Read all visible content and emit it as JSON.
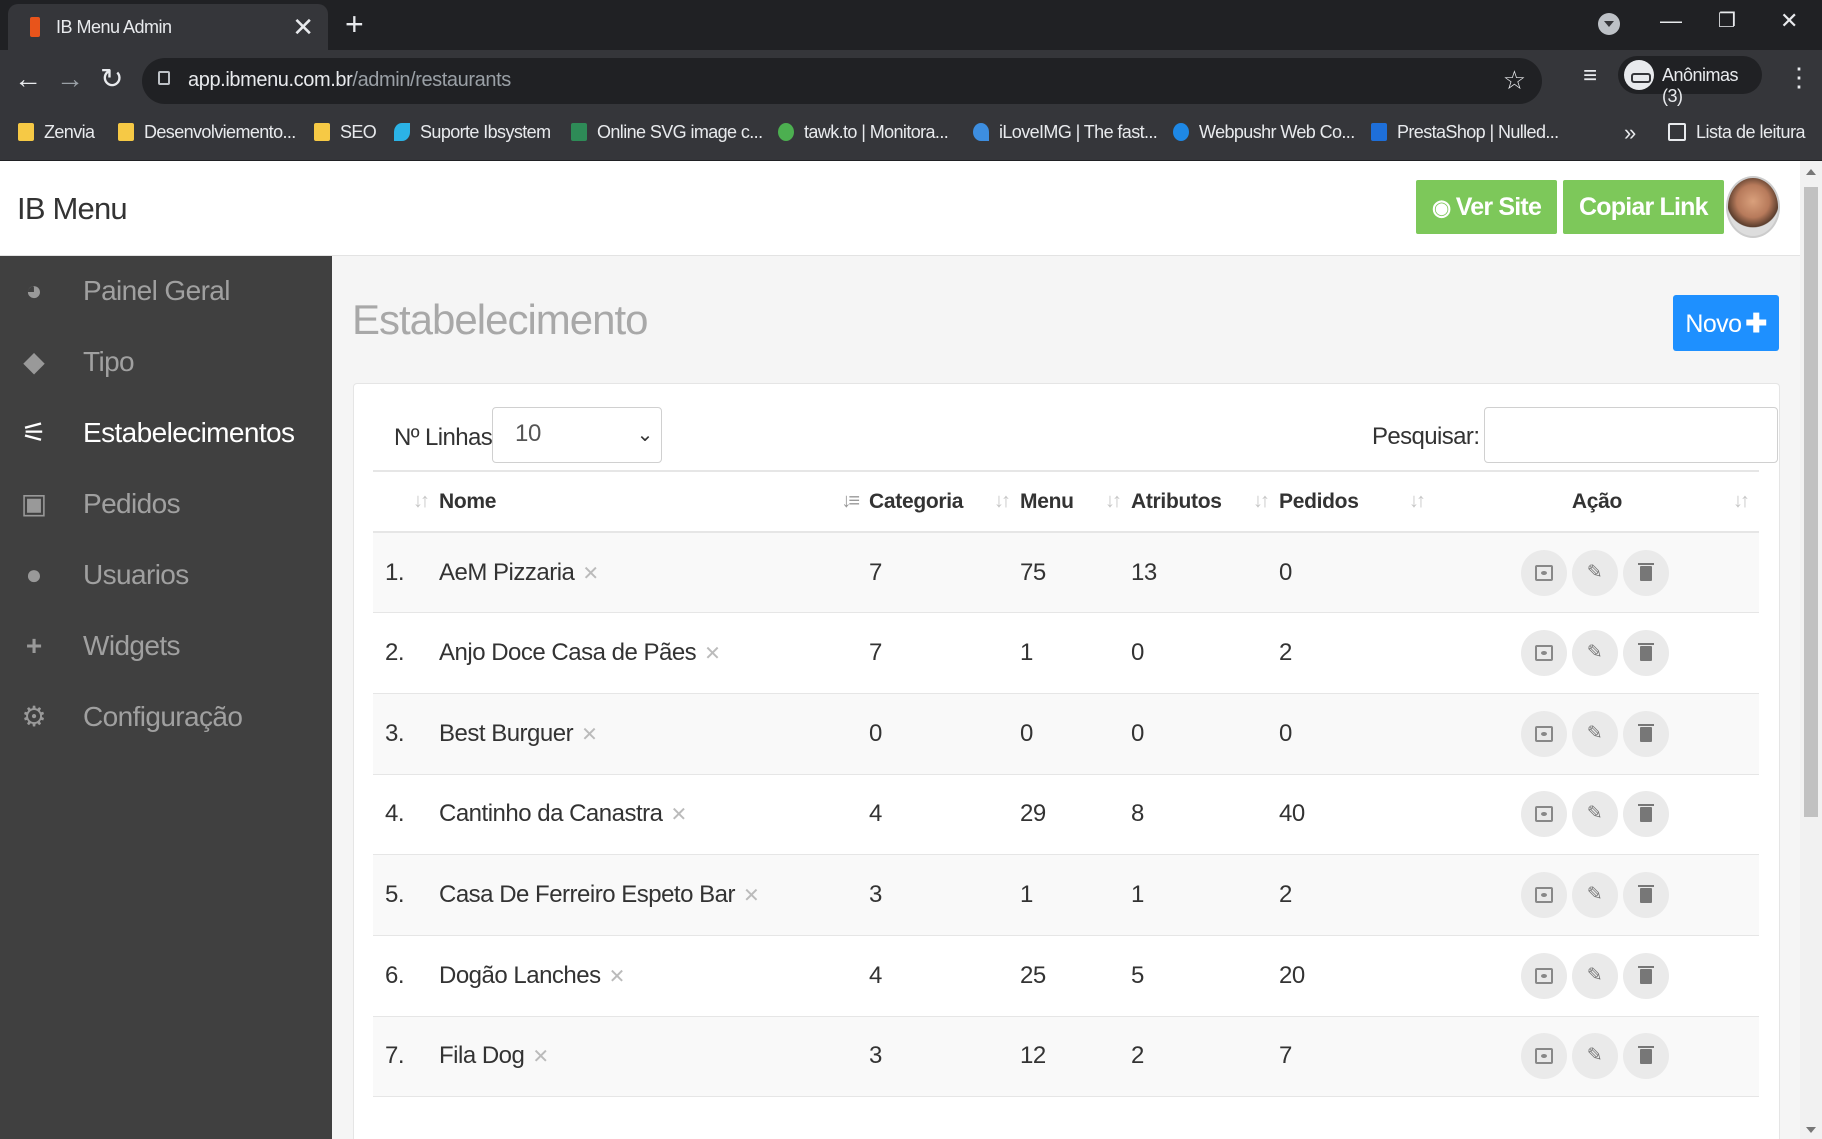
{
  "browser": {
    "tab_title": "IB Menu Admin",
    "tab_close": "✕",
    "new_tab": "+",
    "url_host": "app.ibmenu.com.br",
    "url_path": "/admin/restaurants",
    "profile_label": "Anônimas (3)",
    "bookmarks": [
      {
        "label": "Zenvia",
        "icon": "folder-icon",
        "color": "#f6c945"
      },
      {
        "label": "Desenvolviemento...",
        "icon": "folder-icon",
        "color": "#f6c945"
      },
      {
        "label": "SEO",
        "icon": "folder-icon",
        "color": "#f6c945"
      },
      {
        "label": "Suporte Ibsystem",
        "icon": "bird-icon",
        "color": "#2bb3e6"
      },
      {
        "label": "Online SVG image c...",
        "icon": "svg-icon",
        "color": "#2e8b57"
      },
      {
        "label": "tawk.to | Monitora...",
        "icon": "tawk-icon",
        "color": "#4caf50"
      },
      {
        "label": "iLoveIMG | The fast...",
        "icon": "heart-icon",
        "color": "#3d8ee0"
      },
      {
        "label": "Webpushr Web Co...",
        "icon": "drop-icon",
        "color": "#1e88e5"
      },
      {
        "label": "PrestaShop | Nulled...",
        "icon": "n-icon",
        "color": "#1e6fd9"
      }
    ],
    "more_bookmarks": "»",
    "reading_list": "Lista de leitura"
  },
  "app": {
    "brand": "IB Menu",
    "ver_site": "Ver Site",
    "copiar_link": "Copiar Link",
    "accent_green": "#7dc85a",
    "accent_blue": "#1e90ff"
  },
  "sidebar": {
    "items": [
      {
        "label": "Painel Geral",
        "icon": "dashboard-icon",
        "active": false
      },
      {
        "label": "Tipo",
        "icon": "tags-icon",
        "active": false
      },
      {
        "label": "Estabelecimentos",
        "icon": "utensils-icon",
        "active": true
      },
      {
        "label": "Pedidos",
        "icon": "cart-icon",
        "active": false
      },
      {
        "label": "Usuarios",
        "icon": "users-icon",
        "active": false
      },
      {
        "label": "Widgets",
        "icon": "plus-icon",
        "active": false
      },
      {
        "label": "Configuração",
        "icon": "gear-icon",
        "active": false
      }
    ]
  },
  "main": {
    "title": "Estabelecimento",
    "novo": "Novo",
    "lines_label": "Nº Linhas",
    "lines_value": "10",
    "search_label": "Pesquisar:",
    "search_value": "",
    "columns": [
      "",
      "Nome",
      "Categoria",
      "Menu",
      "Atributos",
      "Pedidos",
      "Ação"
    ],
    "rows": [
      {
        "n": "1.",
        "nome": "AeM Pizzaria",
        "categoria": "7",
        "menu": "75",
        "atributos": "13",
        "pedidos": "0"
      },
      {
        "n": "2.",
        "nome": "Anjo Doce Casa de Pães",
        "categoria": "7",
        "menu": "1",
        "atributos": "0",
        "pedidos": "2"
      },
      {
        "n": "3.",
        "nome": "Best Burguer",
        "categoria": "0",
        "menu": "0",
        "atributos": "0",
        "pedidos": "0"
      },
      {
        "n": "4.",
        "nome": "Cantinho da Canastra",
        "categoria": "4",
        "menu": "29",
        "atributos": "8",
        "pedidos": "40"
      },
      {
        "n": "5.",
        "nome": "Casa De Ferreiro Espeto Bar",
        "categoria": "3",
        "menu": "1",
        "atributos": "1",
        "pedidos": "2"
      },
      {
        "n": "6.",
        "nome": "Dogão Lanches",
        "categoria": "4",
        "menu": "25",
        "atributos": "5",
        "pedidos": "20"
      },
      {
        "n": "7.",
        "nome": "Fila Dog",
        "categoria": "3",
        "menu": "12",
        "atributos": "2",
        "pedidos": "7"
      }
    ]
  }
}
